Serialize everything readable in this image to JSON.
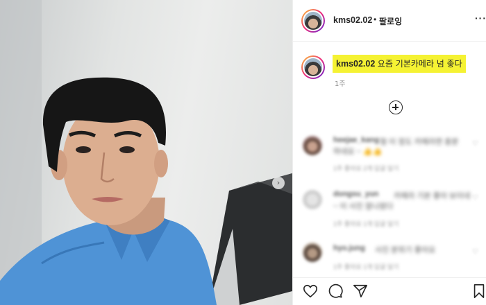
{
  "header": {
    "username": "kms02.02",
    "dot": "•",
    "follow_status": "팔로잉",
    "more_icon": "more-options-icon"
  },
  "caption": {
    "username": "kms02.02",
    "text": "요즘 기본카메라 넘 좋다",
    "time": "1주",
    "highlight_color": "#f5f233"
  },
  "load_more_icon": "plus-circle-icon",
  "comments": [
    {
      "username": "heejae_kang",
      "text": "형 이 정도 카메라면 충분",
      "text2": "하네요 ~ 👍👍",
      "meta": "1주   좋아요 2개   답글 달기"
    },
    {
      "username": "dongsu_yun",
      "text": "카메라 기본 좋아 보이네",
      "text2": "~ 이 사진 잘나왔다",
      "meta": "1주   좋아요 1개   답글 달기"
    },
    {
      "username": "hyo.jung",
      "text": "사진 분위기 좋아요",
      "text2": "",
      "meta": "1주   좋아요 1개   답글 달기"
    }
  ],
  "actions": {
    "like_icon": "heart-icon",
    "comment_icon": "comment-icon",
    "share_icon": "share-icon",
    "save_icon": "bookmark-icon"
  },
  "photo": {
    "description_icon": "post-photo",
    "carousel_icon": "chevron-right-icon",
    "carousel_glyph": "›"
  }
}
